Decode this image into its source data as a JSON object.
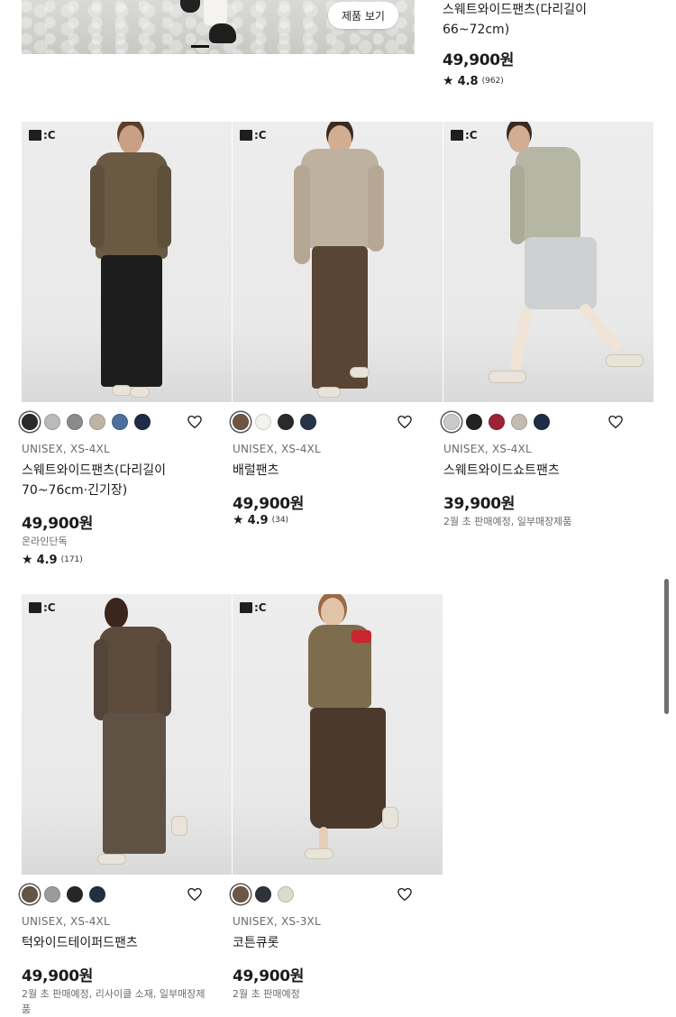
{
  "banner": {
    "button_label": "제품 보기"
  },
  "top_product": {
    "name": "스웨트와이드팬츠(다리길이 66~72cm)",
    "price": "49,900원",
    "rating": "4.8",
    "review_count": "(962)"
  },
  "brand_logo_text": ":C",
  "products": [
    {
      "size": "UNISEX, XS-4XL",
      "name": "스웨트와이드팬츠(다리길이 70~76cm·긴기장)",
      "price": "49,900원",
      "note": "온라인단독",
      "rating": "4.9",
      "review_count": "(171)",
      "colors": [
        "#2b2b2b",
        "#b9babc",
        "#8a8a8a",
        "#bfb3a6",
        "#4c6f9c",
        "#1f2c45"
      ]
    },
    {
      "size": "UNISEX, XS-4XL",
      "name": "배럴팬츠",
      "price": "49,900원",
      "rating": "4.9",
      "review_count": "(34)",
      "colors": [
        "#6e5645",
        "#f4f2ee",
        "#2a2a2a",
        "#273349"
      ]
    },
    {
      "size": "UNISEX, XS-4XL",
      "name": "스웨트와이드쇼트팬츠",
      "price": "39,900원",
      "note": "2월 초 판매예정, 일부매장제품",
      "colors": [
        "#c9cacb",
        "#222222",
        "#9b2335",
        "#c4bbb3",
        "#1f2c45"
      ]
    },
    {
      "size": "UNISEX, XS-4XL",
      "name": "턱와이드테이퍼드팬츠",
      "price": "49,900원",
      "note": "2월 초 판매예정, 리사이클 소재, 일부매장제품",
      "colors": [
        "#645545",
        "#9a9b9c",
        "#262626",
        "#213041"
      ]
    },
    {
      "size": "UNISEX, XS-3XL",
      "name": "코튼큐롯",
      "price": "49,900원",
      "note": "2월 초 판매예정",
      "colors": [
        "#6e5645",
        "#2f3338",
        "#dcdccc"
      ]
    }
  ]
}
